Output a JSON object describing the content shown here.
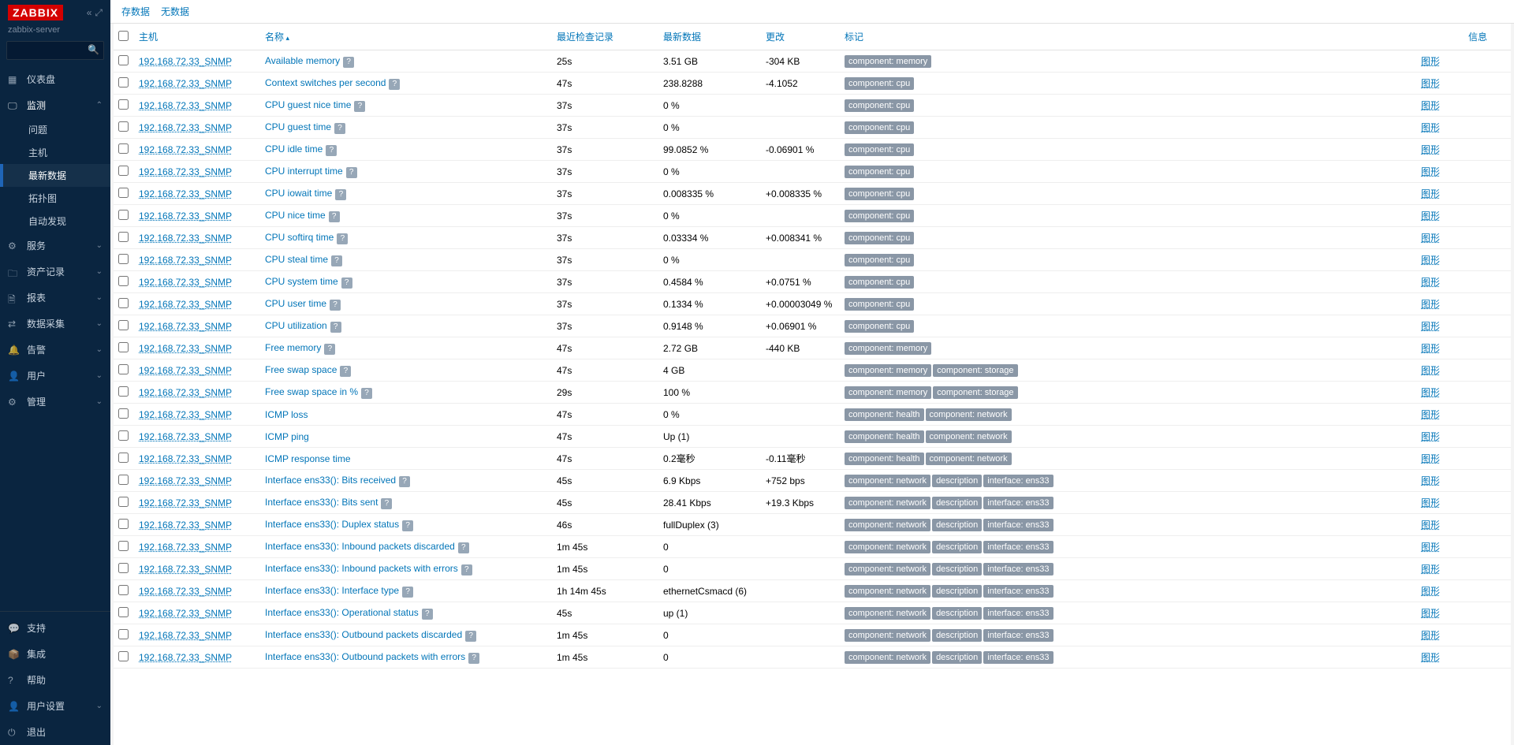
{
  "brand": "ZABBIX",
  "server_name": "zabbix-server",
  "nav": {
    "dashboards": "仪表盘",
    "monitoring": "监测",
    "mon_sub": [
      "问题",
      "主机",
      "最新数据",
      "拓扑图",
      "自动发现"
    ],
    "services": "服务",
    "inventory": "资产记录",
    "reports": "报表",
    "dataCollection": "数据采集",
    "alerts": "告警",
    "users": "用户",
    "administration": "管理",
    "support": "支持",
    "integrations": "集成",
    "help": "帮助",
    "userSettings": "用户设置",
    "signout": "退出"
  },
  "topbar": {
    "has_data": "存数据",
    "no_data": "无数据"
  },
  "headers": {
    "host": "主机",
    "name": "名称",
    "last_check": "最近检查记录",
    "last_data": "最新数据",
    "change": "更改",
    "tags": "标记",
    "info": "信息",
    "graph": "图形"
  },
  "host": "192.168.72.33_SNMP",
  "graph_label": "图形",
  "rows": [
    {
      "name": "Available memory",
      "q": true,
      "lc": "25s",
      "ld": "3.51 GB",
      "chg": "-304 KB",
      "tags": [
        "component: memory"
      ]
    },
    {
      "name": "Context switches per second",
      "q": true,
      "lc": "47s",
      "ld": "238.8288",
      "chg": "-4.1052",
      "tags": [
        "component: cpu"
      ]
    },
    {
      "name": "CPU guest nice time",
      "q": true,
      "lc": "37s",
      "ld": "0 %",
      "chg": "",
      "tags": [
        "component: cpu"
      ]
    },
    {
      "name": "CPU guest time",
      "q": true,
      "lc": "37s",
      "ld": "0 %",
      "chg": "",
      "tags": [
        "component: cpu"
      ]
    },
    {
      "name": "CPU idle time",
      "q": true,
      "lc": "37s",
      "ld": "99.0852 %",
      "chg": "-0.06901 %",
      "tags": [
        "component: cpu"
      ]
    },
    {
      "name": "CPU interrupt time",
      "q": true,
      "lc": "37s",
      "ld": "0 %",
      "chg": "",
      "tags": [
        "component: cpu"
      ]
    },
    {
      "name": "CPU iowait time",
      "q": true,
      "lc": "37s",
      "ld": "0.008335 %",
      "chg": "+0.008335 %",
      "tags": [
        "component: cpu"
      ]
    },
    {
      "name": "CPU nice time",
      "q": true,
      "lc": "37s",
      "ld": "0 %",
      "chg": "",
      "tags": [
        "component: cpu"
      ]
    },
    {
      "name": "CPU softirq time",
      "q": true,
      "lc": "37s",
      "ld": "0.03334 %",
      "chg": "+0.008341 %",
      "tags": [
        "component: cpu"
      ]
    },
    {
      "name": "CPU steal time",
      "q": true,
      "lc": "37s",
      "ld": "0 %",
      "chg": "",
      "tags": [
        "component: cpu"
      ]
    },
    {
      "name": "CPU system time",
      "q": true,
      "lc": "37s",
      "ld": "0.4584 %",
      "chg": "+0.0751 %",
      "tags": [
        "component: cpu"
      ]
    },
    {
      "name": "CPU user time",
      "q": true,
      "lc": "37s",
      "ld": "0.1334 %",
      "chg": "+0.00003049 %",
      "tags": [
        "component: cpu"
      ]
    },
    {
      "name": "CPU utilization",
      "q": true,
      "lc": "37s",
      "ld": "0.9148 %",
      "chg": "+0.06901 %",
      "tags": [
        "component: cpu"
      ]
    },
    {
      "name": "Free memory",
      "q": true,
      "lc": "47s",
      "ld": "2.72 GB",
      "chg": "-440 KB",
      "tags": [
        "component: memory"
      ]
    },
    {
      "name": "Free swap space",
      "q": true,
      "lc": "47s",
      "ld": "4 GB",
      "chg": "",
      "tags": [
        "component: memory",
        "component: storage"
      ]
    },
    {
      "name": "Free swap space in %",
      "q": true,
      "lc": "29s",
      "ld": "100 %",
      "chg": "",
      "tags": [
        "component: memory",
        "component: storage"
      ]
    },
    {
      "name": "ICMP loss",
      "q": false,
      "lc": "47s",
      "ld": "0 %",
      "chg": "",
      "tags": [
        "component: health",
        "component: network"
      ]
    },
    {
      "name": "ICMP ping",
      "q": false,
      "lc": "47s",
      "ld": "Up (1)",
      "chg": "",
      "tags": [
        "component: health",
        "component: network"
      ]
    },
    {
      "name": "ICMP response time",
      "q": false,
      "lc": "47s",
      "ld": "0.2毫秒",
      "chg": "-0.11毫秒",
      "tags": [
        "component: health",
        "component: network"
      ]
    },
    {
      "name": "Interface ens33(): Bits received",
      "q": true,
      "lc": "45s",
      "ld": "6.9 Kbps",
      "chg": "+752 bps",
      "tags": [
        "component: network",
        "description",
        "interface: ens33"
      ]
    },
    {
      "name": "Interface ens33(): Bits sent",
      "q": true,
      "lc": "45s",
      "ld": "28.41 Kbps",
      "chg": "+19.3 Kbps",
      "tags": [
        "component: network",
        "description",
        "interface: ens33"
      ]
    },
    {
      "name": "Interface ens33(): Duplex status",
      "q": true,
      "lc": "46s",
      "ld": "fullDuplex (3)",
      "chg": "",
      "tags": [
        "component: network",
        "description",
        "interface: ens33"
      ]
    },
    {
      "name": "Interface ens33(): Inbound packets discarded",
      "q": true,
      "lc": "1m 45s",
      "ld": "0",
      "chg": "",
      "tags": [
        "component: network",
        "description",
        "interface: ens33"
      ]
    },
    {
      "name": "Interface ens33(): Inbound packets with errors",
      "q": true,
      "lc": "1m 45s",
      "ld": "0",
      "chg": "",
      "tags": [
        "component: network",
        "description",
        "interface: ens33"
      ]
    },
    {
      "name": "Interface ens33(): Interface type",
      "q": true,
      "lc": "1h 14m 45s",
      "ld": "ethernetCsmacd (6)",
      "chg": "",
      "tags": [
        "component: network",
        "description",
        "interface: ens33"
      ]
    },
    {
      "name": "Interface ens33(): Operational status",
      "q": true,
      "lc": "45s",
      "ld": "up (1)",
      "chg": "",
      "tags": [
        "component: network",
        "description",
        "interface: ens33"
      ]
    },
    {
      "name": "Interface ens33(): Outbound packets discarded",
      "q": true,
      "lc": "1m 45s",
      "ld": "0",
      "chg": "",
      "tags": [
        "component: network",
        "description",
        "interface: ens33"
      ]
    },
    {
      "name": "Interface ens33(): Outbound packets with errors",
      "q": true,
      "lc": "1m 45s",
      "ld": "0",
      "chg": "",
      "tags": [
        "component: network",
        "description",
        "interface: ens33"
      ]
    }
  ]
}
